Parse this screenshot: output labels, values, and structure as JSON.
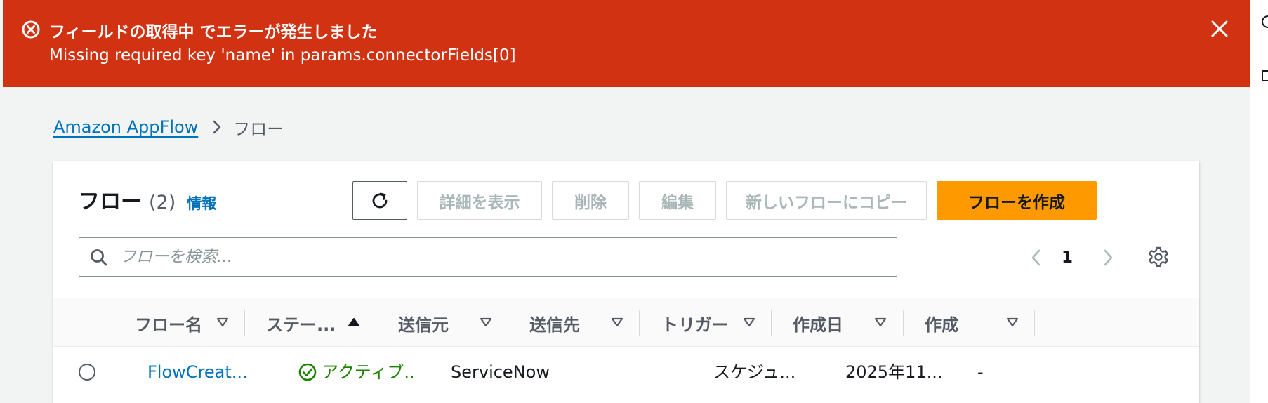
{
  "flash": {
    "title": "フィールドの取得中 でエラーが発生しました",
    "message": "Missing required key 'name' in params.connectorFields[0]",
    "icon": "error-circle-x-icon",
    "color": "#d13212"
  },
  "breadcrumb": {
    "root": "Amazon AppFlow",
    "current": "フロー"
  },
  "panel": {
    "title": "フロー",
    "count": "(2)",
    "info": "情報"
  },
  "toolbar": {
    "view_details": "詳細を表示",
    "delete": "削除",
    "edit": "編集",
    "copy": "新しいフローにコピー",
    "create": "フローを作成"
  },
  "search": {
    "placeholder": "フローを検索..."
  },
  "pagination": {
    "current_page": "1"
  },
  "table": {
    "columns": [
      "フロー名",
      "ステー...",
      "送信元",
      "送信先",
      "トリガー",
      "作成日",
      "作成"
    ],
    "sorted_column": "ステー...",
    "rows": [
      {
        "name": "FlowCreat...",
        "status": "アクティブ..",
        "source": "ServiceNow",
        "destination": "",
        "trigger": "スケジュ...",
        "created": "2025年11...",
        "created_by": "-"
      }
    ]
  },
  "colors": {
    "primary_button": "#ff9900",
    "link": "#0073bb",
    "active_status": "#1d8102"
  }
}
